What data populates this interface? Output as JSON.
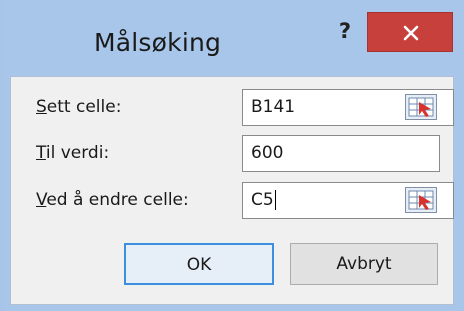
{
  "dialog": {
    "title": "Målsøking",
    "help_label": "?",
    "rows": [
      {
        "label_underlined": "S",
        "label_rest": "ett celle:",
        "value": "B141"
      },
      {
        "label_underlined": "T",
        "label_rest": "il verdi:",
        "value": "600"
      },
      {
        "label_underlined": "V",
        "label_rest": "ed å endre celle:",
        "value": "C5"
      }
    ],
    "ok_label": "OK",
    "cancel_label": "Avbryt"
  },
  "colors": {
    "close_button": "#c7403c",
    "frame": "#a8c6ea",
    "focus_border": "#3c8ee0"
  }
}
